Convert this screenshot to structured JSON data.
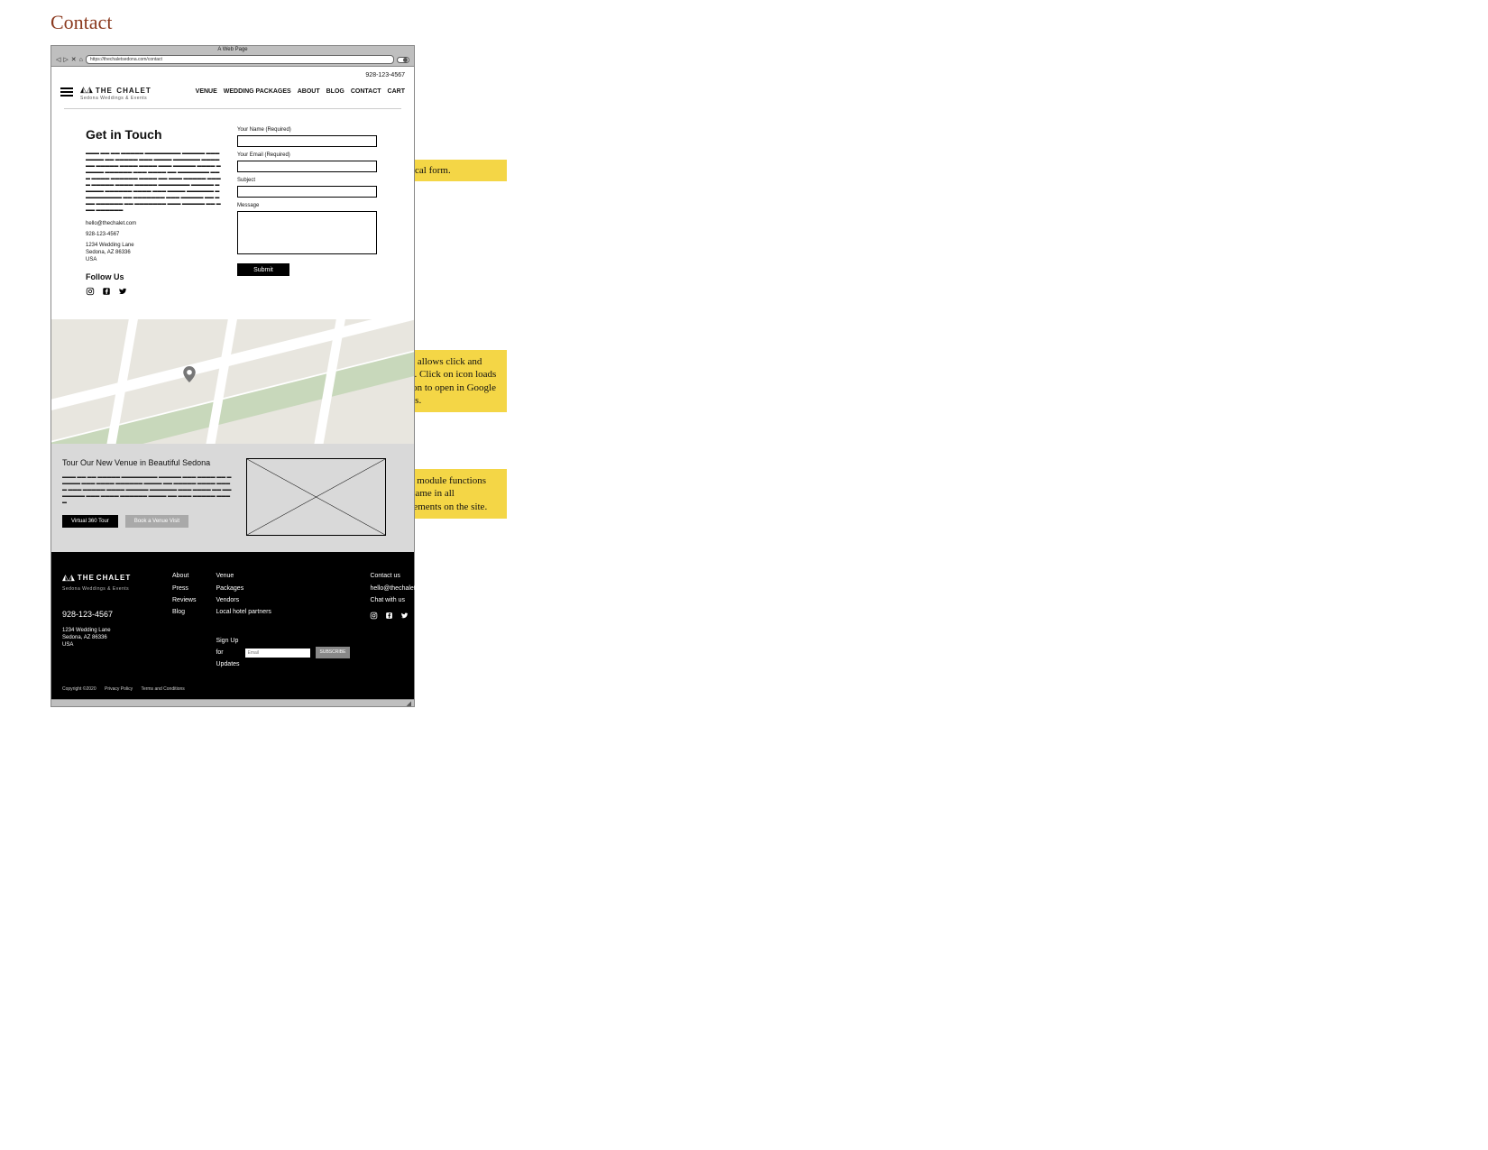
{
  "page_title": "Contact",
  "browser": {
    "window_label": "A Web Page",
    "url": "https://thechaletsedona.com/contact"
  },
  "header": {
    "phone": "928-123-4567",
    "logo_top": "THE",
    "logo_bottom": "CHALET",
    "logo_sub": "Sedona Weddings & Events",
    "nav": [
      "VENUE",
      "WEDDING PACKAGES",
      "ABOUT",
      "BLOG",
      "CONTACT",
      "CART"
    ]
  },
  "contact": {
    "heading": "Get in Touch",
    "email": "hello@thechalet.com",
    "phone": "928-123-4567",
    "address_lines": [
      "1234 Wedding Lane",
      "Sedona, AZ 86336",
      "USA"
    ],
    "follow_heading": "Follow Us",
    "form": {
      "name_label": "Your Name (Required)",
      "email_label": "Your Email (Required)",
      "subject_label": "Subject",
      "message_label": "Message",
      "submit_label": "Submit"
    }
  },
  "tour": {
    "heading": "Tour Our New Venue in Beautiful Sedona",
    "btn_primary": "Virtual 360 Tour",
    "btn_secondary": "Book a Venue Visit"
  },
  "footer": {
    "phone": "928-123-4567",
    "address_lines": [
      "1234 Wedding Lane",
      "Sedona, AZ 86336",
      "USA"
    ],
    "col2": [
      "About",
      "Press",
      "Reviews",
      "Blog"
    ],
    "col3": [
      "Venue",
      "Packages",
      "Vendors",
      "Local hotel partners"
    ],
    "col4_heading": "Contact us",
    "col4_email": "hello@thechalet.com",
    "col4_chat": "Chat with us",
    "signup_label": "Sign Up for Updates",
    "signup_placeholder": "Email",
    "subscribe_label": "SUBSCRIBE",
    "legal": [
      "Copyright ©2020",
      "Privacy Policy",
      "Terms and Conditions"
    ]
  },
  "annotations": {
    "note1": "Typical form.",
    "note2": "Map allows click and drag. Click on icon loads option to open in Google Maps.",
    "note3": "This module functions the same in all placements on the site."
  },
  "greek": "▬▬▬ ▬▬ ▬▬ ▬▬▬▬▬ ▬▬▬▬▬▬▬▬ ▬▬▬▬▬ ▬▬▬ ▬▬▬▬ ▬▬ ▬▬▬▬▬ ▬▬▬ ▬▬▬▬ ▬▬▬▬▬▬ ▬▬▬▬ ▬▬ ▬▬▬▬▬ ▬▬▬▬ ▬▬▬▬ ▬▬▬ ▬▬▬▬▬ ▬▬▬▬ ▬▬▬▬▬ ▬▬▬▬▬▬ ▬▬▬ ▬▬▬▬ ▬▬ ▬▬▬▬▬▬▬ ▬▬▬ ▬▬▬▬ ▬▬▬▬▬▬ ▬▬▬▬ ▬▬ ▬▬▬ ▬▬▬▬▬ ▬▬▬▬ ▬▬▬▬▬ ▬▬▬▬ ▬▬▬▬▬ ▬▬▬▬▬▬▬ ▬▬▬▬▬ ▬▬▬▬▬ ▬▬▬▬▬▬ ▬▬▬▬ ▬▬▬ ▬▬▬▬ ▬▬▬▬▬▬ ▬▬▬▬▬▬▬▬▬ ▬▬ ▬▬▬▬▬▬▬ ▬▬▬ ▬▬▬▬▬ ▬▬ ▬▬▬ ▬▬▬▬▬▬ ▬▬ ▬▬▬▬▬▬▬ ▬▬▬ ▬▬▬▬▬ ▬▬ ▬▬▬ ▬▬▬▬▬▬",
  "tour_greek": "▬▬▬ ▬▬ ▬▬ ▬▬▬▬▬ ▬▬▬▬▬▬▬▬ ▬▬▬▬▬ ▬▬▬ ▬▬▬▬ ▬▬ ▬▬▬▬▬ ▬▬▬ ▬▬▬▬ ▬▬▬▬▬▬ ▬▬▬▬ ▬▬ ▬▬▬▬▬ ▬▬▬▬ ▬▬▬▬ ▬▬▬ ▬▬▬▬▬ ▬▬▬▬ ▬▬▬▬▬ ▬▬▬▬▬▬ ▬▬▬ ▬▬▬▬ ▬▬ ▬▬▬▬▬▬▬ ▬▬▬ ▬▬▬▬ ▬▬▬▬▬▬ ▬▬▬▬ ▬▬ ▬▬▬ ▬▬▬▬▬ ▬▬▬▬"
}
